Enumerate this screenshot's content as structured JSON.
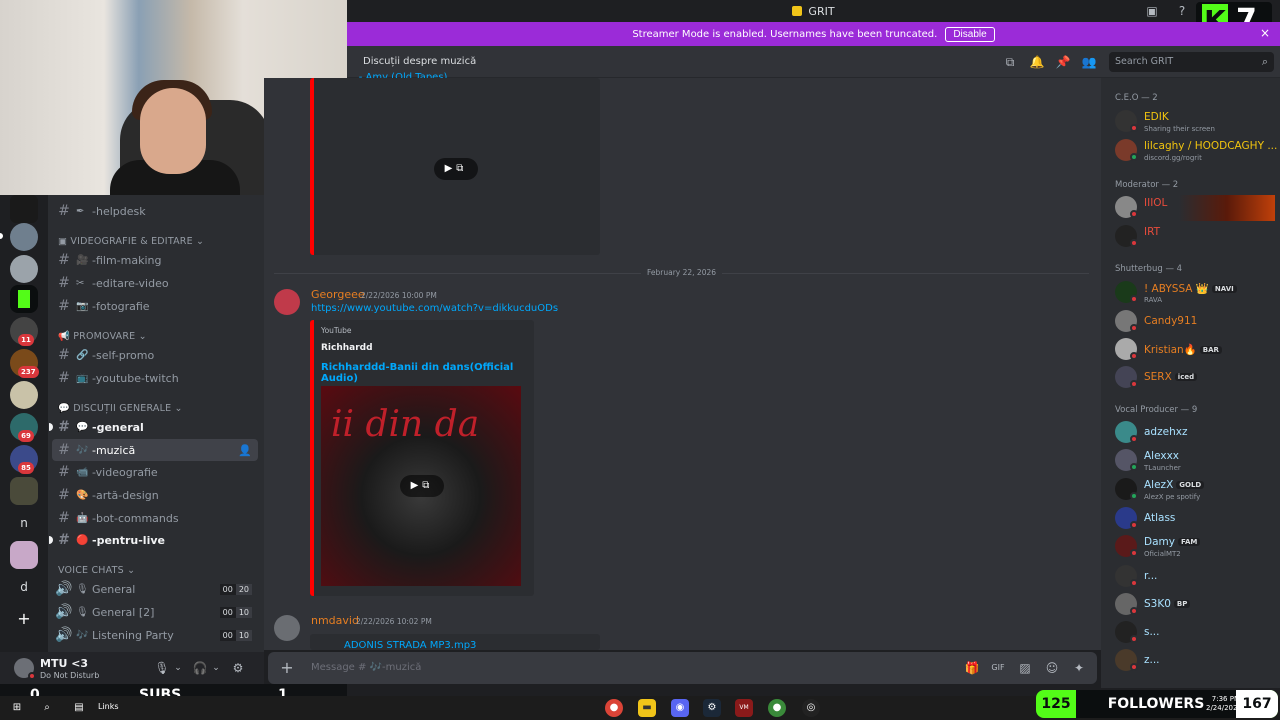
{
  "titlebar": {
    "app_title": "GRIT"
  },
  "banner": {
    "text": "Streamer Mode is enabled. Usernames have been truncated.",
    "disable_label": "Disable",
    "close_icon": "×"
  },
  "kick": {
    "logo": "K",
    "count": "7"
  },
  "user": {
    "name": "MTU <3",
    "status": "Do Not Disturb"
  },
  "subs": {
    "left": "0",
    "label": "SUBS",
    "right": "1"
  },
  "header": {
    "channel_title": "Discuții despre muzică",
    "search_placeholder": "Search GRIT"
  },
  "channels": {
    "top_item": "-helpdesk",
    "cat_video": "VIDEOGRAFIE & EDITARE",
    "film": "-film-making",
    "edit": "-editare-video",
    "foto": "-fotografie",
    "cat_promo": "PROMOVARE",
    "selfpromo": "-self-promo",
    "yt": "-youtube-twitch",
    "cat_disc": "DISCUȚII GENERALE",
    "general": "-general",
    "muzica": "-muzică",
    "videografie": "-videografie",
    "arta": "-artă-design",
    "bot": "-bot-commands",
    "live": "-pentru-live",
    "cat_voice": "VOICE CHATS",
    "v1": "General",
    "v2": "General [2]",
    "v3": "Listening Party",
    "v1a": "00",
    "v1b": "20",
    "v2a": "00",
    "v2b": "10",
    "v3a": "00",
    "v3b": "10"
  },
  "chat": {
    "top_partial": "... - Amy (Old Tapes)",
    "date_divider": "February 22, 2026",
    "m1_name": "Georgeee",
    "m1_time": "2/22/2026 10:00 PM",
    "m1_link": "https://www.youtube.com/watch?v=dikkucduODs",
    "embed_provider": "YouTube",
    "embed_author": "Richhardd",
    "embed_title": "Richharddd-Banii din dans(Official Audio)",
    "thumb_text": "ii din da",
    "m2_name": "nmdavid",
    "m2_time": "2/22/2026 10:02 PM",
    "m2_file": "ADONIS STRADA MP3.mp3",
    "composer_placeholder": "Message # 🎶-muzică"
  },
  "members": {
    "role_ceo": "C.E.O — 2",
    "ceo1": "EDIK",
    "ceo1_sub": "Sharing their screen",
    "ceo2": "lilcaghy / HOODCAGHY ...",
    "ceo2_sub": "discord.gg/rogrit",
    "role_mod": "Moderator — 2",
    "mod1": "IIIOL",
    "mod2": "IRT",
    "role_shutter": "Shutterbug — 4",
    "s1": "! ABYSSA",
    "s1_tag": "NAVI",
    "s1_sub": "RAVA",
    "s2": "Candy911",
    "s3": "Kristian",
    "s3_tag": "BAR",
    "s4": "SERX",
    "s4_tag": "iced",
    "role_vocal": "Vocal Producer — 9",
    "v1": "adzehxz",
    "v2": "Alexxx",
    "v2_sub": "TLauncher",
    "v3": "AlezX",
    "v3_tag": "GOLD",
    "v3_sub": "AlezX pe spotify",
    "v4": "Atlass",
    "v5": "Damy",
    "v5_tag": "FAM",
    "v5_sub": "OficialMT2",
    "v6": "r...",
    "v7": "S3K0",
    "v7_tag": "BP",
    "v8": "s...",
    "v9": "z..."
  },
  "followers": {
    "count": "125",
    "label": "FOLLOWERS",
    "goal": "167",
    "clock": "7:36 PM",
    "date": "2/24/2026"
  },
  "taskbar": {
    "links_label": "Links"
  }
}
